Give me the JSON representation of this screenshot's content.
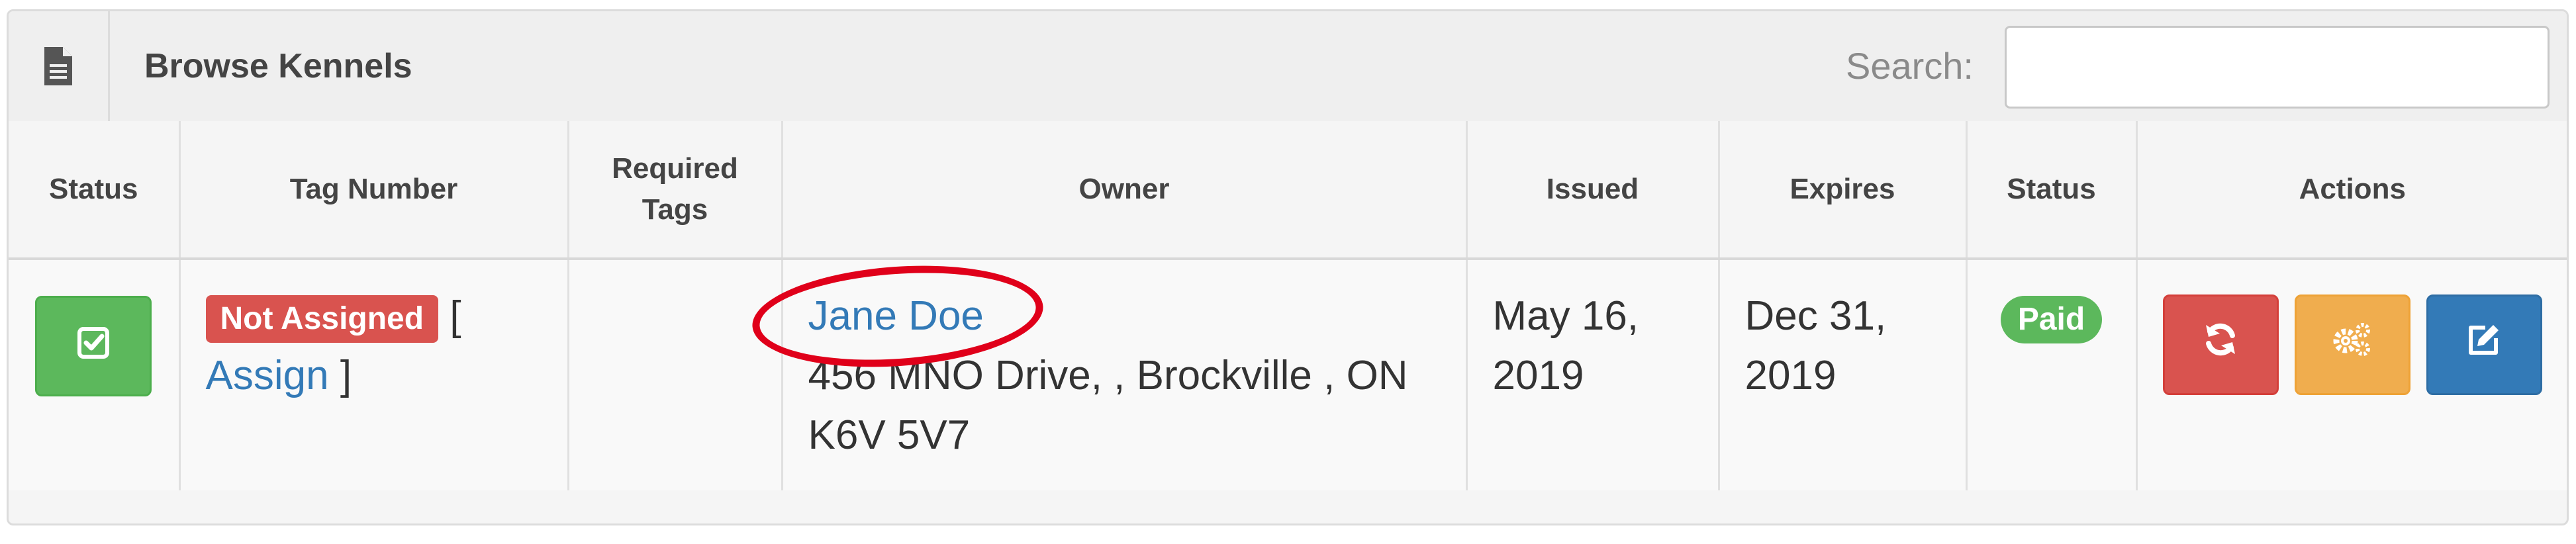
{
  "panel": {
    "title": "Browse Kennels",
    "search_label": "Search:",
    "search_value": "",
    "title_icon": "file-icon"
  },
  "table": {
    "headers": [
      "Status",
      "Tag Number",
      "Required Tags",
      "Owner",
      "Issued",
      "Expires",
      "Status",
      "Actions"
    ],
    "rows": [
      {
        "status_icon": "check-square-icon",
        "tag_label": "Not Assigned",
        "bracket_open": "[",
        "assign_link": "Assign",
        "bracket_close": "]",
        "required_tags": "",
        "owner_name": "Jane Doe",
        "owner_address": "456 MNO Drive, , Brockville , ON K6V 5V7",
        "issued": "May 16, 2019",
        "expires": "Dec 31, 2019",
        "payment_status": "Paid",
        "actions": [
          "renew-icon",
          "settings-icon",
          "edit-icon"
        ]
      }
    ]
  },
  "colors": {
    "success": "#5cb85c",
    "danger": "#d9534f",
    "warning": "#f0ad4e",
    "primary": "#337ab7",
    "annotation": "#e0001a"
  }
}
